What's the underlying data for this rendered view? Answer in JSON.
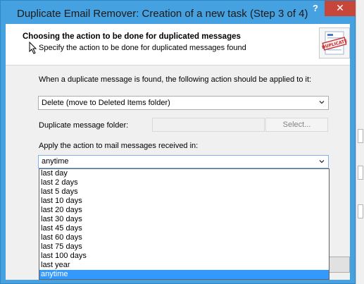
{
  "window": {
    "title": "Duplicate Email Remover: Creation of a new task (Step 3 of 4)",
    "help_symbol": "?",
    "close_symbol": "✕"
  },
  "header": {
    "heading": "Choosing the action to be done for duplicated messages",
    "subheading": "Specify the action to be done for duplicated messages found",
    "stamp_text": "DUPLICATE"
  },
  "form": {
    "action_prompt": "When a duplicate message is found, the following action should be applied to it:",
    "action_value": "Delete (move to Deleted Items folder)",
    "folder_label": "Duplicate message folder:",
    "folder_value": "",
    "select_button": "Select...",
    "period_label": "Apply the action to mail messages received in:",
    "period_value": "anytime"
  },
  "dropdown": {
    "options": [
      "last day",
      "last 2 days",
      "last 5 days",
      "last 10 days",
      "last 20 days",
      "last 30 days",
      "last 45 days",
      "last 60 days",
      "last 75 days",
      "last 100 days",
      "last year",
      "anytime"
    ],
    "selected": "anytime"
  },
  "colors": {
    "title_bar": "#45a1e0",
    "close_button": "#c7463a",
    "selection": "#3399ff"
  }
}
